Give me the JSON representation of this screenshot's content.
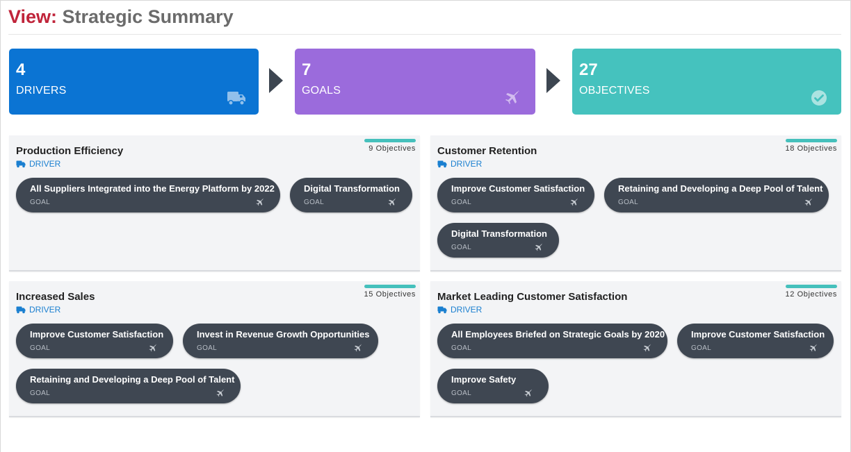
{
  "header": {
    "prefix": "View:",
    "title": "Strategic Summary"
  },
  "summary": {
    "drivers": {
      "count": "4",
      "label": "DRIVERS",
      "color": "#0b74d3",
      "icon": "truck-icon"
    },
    "goals": {
      "count": "7",
      "label": "GOALS",
      "color": "#9b6bdc",
      "icon": "plane-icon"
    },
    "objectives": {
      "count": "27",
      "label": "OBJECTIVES",
      "color": "#45c2be",
      "icon": "check-circle-icon"
    }
  },
  "cards": [
    {
      "title": "Production Efficiency",
      "type": "DRIVER",
      "objectives": "9 Objectives",
      "goals": [
        {
          "title": "All Suppliers Integrated into the Energy Platform by 2022",
          "sub": "GOAL"
        },
        {
          "title": "Digital Transformation",
          "sub": "GOAL"
        }
      ]
    },
    {
      "title": "Customer Retention",
      "type": "DRIVER",
      "objectives": "18 Objectives",
      "goals": [
        {
          "title": "Improve Customer Satisfaction",
          "sub": "GOAL"
        },
        {
          "title": "Retaining and Developing a Deep Pool of Talent",
          "sub": "GOAL"
        },
        {
          "title": "Digital Transformation",
          "sub": "GOAL"
        }
      ]
    },
    {
      "title": "Increased Sales",
      "type": "DRIVER",
      "objectives": "15 Objectives",
      "goals": [
        {
          "title": "Improve Customer Satisfaction",
          "sub": "GOAL"
        },
        {
          "title": "Invest in Revenue Growth Opportunities",
          "sub": "GOAL"
        },
        {
          "title": "Retaining and Developing a Deep Pool of Talent",
          "sub": "GOAL"
        }
      ]
    },
    {
      "title": "Market Leading Customer Satisfaction",
      "type": "DRIVER",
      "objectives": "12 Objectives",
      "goals": [
        {
          "title": "All Employees Briefed on Strategic Goals by 2020",
          "sub": "GOAL"
        },
        {
          "title": "Improve Customer Satisfaction",
          "sub": "GOAL"
        },
        {
          "title": "Improve Safety",
          "sub": "GOAL"
        }
      ]
    }
  ]
}
